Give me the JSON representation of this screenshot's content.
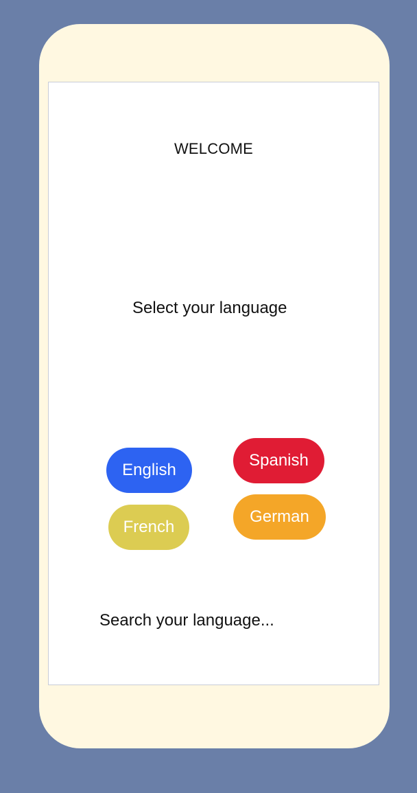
{
  "screen": {
    "title": "WELCOME",
    "subtitle": "Select your language"
  },
  "languages": [
    {
      "label": "English",
      "color": "#2d63f2"
    },
    {
      "label": "Spanish",
      "color": "#e01c34"
    },
    {
      "label": "French",
      "color": "#dccc52"
    },
    {
      "label": "German",
      "color": "#f4a628"
    }
  ],
  "search": {
    "placeholder": "Search your language..."
  },
  "colors": {
    "background": "#6a7fa8",
    "phone_frame": "#fff8e1",
    "screen": "#ffffff"
  }
}
